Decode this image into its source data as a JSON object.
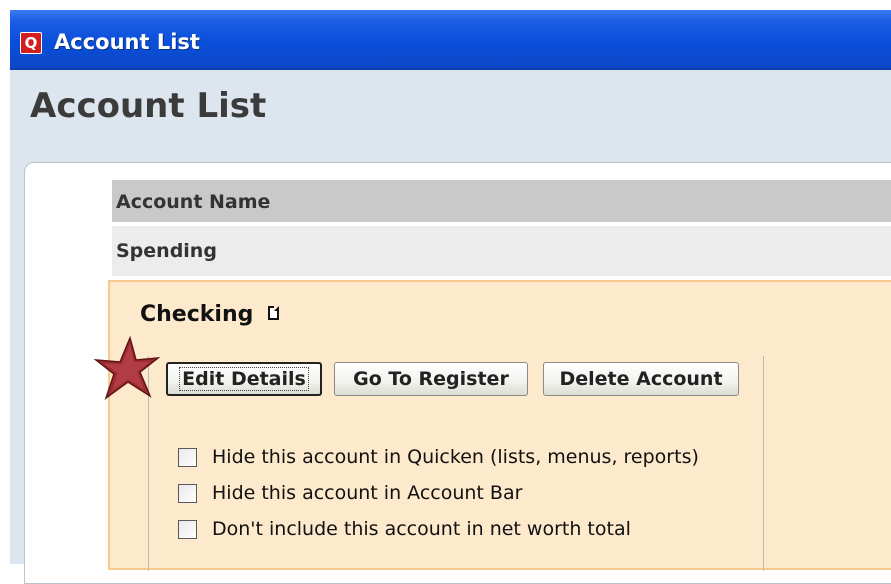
{
  "window": {
    "title": "Account List",
    "app_icon": "Q"
  },
  "page": {
    "heading": "Account List"
  },
  "table": {
    "header": "Account Name",
    "group": "Spending",
    "selected_account": {
      "name": "Checking",
      "buttons": {
        "edit": "Edit Details",
        "goto": "Go To Register",
        "delete": "Delete Account"
      },
      "options": [
        {
          "label": "Hide this account in Quicken (lists, menus, reports)",
          "checked": false
        },
        {
          "label": "Hide this account in Account Bar",
          "checked": false
        },
        {
          "label": "Don't include this account in net worth total",
          "checked": false
        }
      ]
    }
  },
  "colors": {
    "titlebar": "#0a4fd9",
    "selected_bg": "#fde9cb",
    "selected_border": "#f7c98a",
    "star": "#9e2b32"
  }
}
